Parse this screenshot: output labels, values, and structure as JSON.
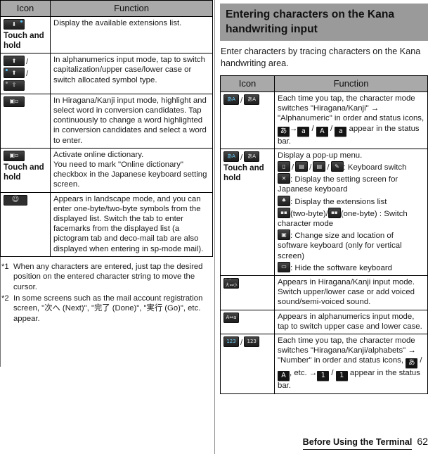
{
  "document": {
    "footer_title": "Before Using the Terminal",
    "page_number": "62"
  },
  "left_page": {
    "table": {
      "headers": {
        "icon": "Icon",
        "function": "Function"
      },
      "rows": [
        {
          "icon_note": "Touch and hold",
          "icon_glyphs": [
            "arrow-down-key-icon"
          ],
          "function": "Display the available extensions list."
        },
        {
          "icon_note": "",
          "icon_glyphs": [
            "shift-key-icon",
            "shift-key-blue-dot-icon",
            "shift-outline-key-icon"
          ],
          "function": "In alphanumerics input mode, tap to switch capitalization/upper case/lower case or switch allocated symbol type."
        },
        {
          "icon_note": "",
          "icon_glyphs": [
            "conversion-candidate-key-icon"
          ],
          "function": "In Hiragana/Kanji input mode, highlight and select word in conversion candidates. Tap continuously to change a word highlighted in conversion candidates and select a word to enter."
        },
        {
          "icon_note": "Touch and hold",
          "icon_glyphs": [
            "online-dictionary-key-icon"
          ],
          "function": "Activate online dictionary.\nYou need to mark \"Online dictionary\" checkbox in the Japanese keyboard setting screen."
        },
        {
          "icon_note": "",
          "icon_glyphs": [
            "facemark-key-icon"
          ],
          "function": "Appears in landscape mode, and you can enter one-byte/two-byte symbols from the displayed list. Switch the tab to enter facemarks from the displayed list (a pictogram tab and deco-mail tab are also displayed when entering in sp-mode mail)."
        }
      ]
    },
    "footnotes": [
      {
        "mark": "*1",
        "text": "When any characters are entered, just tap the desired position on the entered character string to move the cursor."
      },
      {
        "mark": "*2",
        "text": "In some screens such as the mail account registration screen, \"次へ (Next)\", \"完了 (Done)\", \"実行 (Go)\", etc. appear."
      }
    ]
  },
  "right_page": {
    "section_title": "Entering characters on the Kana handwriting input",
    "intro": "Enter characters by tracing characters on the Kana handwriting area.",
    "table": {
      "headers": {
        "icon": "Icon",
        "function": "Function"
      },
      "rows": [
        {
          "icon_note": "",
          "icon_glyphs": [
            "char-mode-key-icon",
            "char-mode-key-alt-icon"
          ],
          "function_parts": [
            {
              "type": "text",
              "value": "Each time you tap, the character mode switches \"Hiragana/Kanji\" → \"Alphanumeric\" in order and status icons, "
            },
            {
              "type": "status",
              "value": "あ"
            },
            {
              "type": "text",
              "value": "→"
            },
            {
              "type": "status",
              "value": "a"
            },
            {
              "type": "text",
              "value": " / "
            },
            {
              "type": "status",
              "value": "A"
            },
            {
              "type": "text",
              "value": " / "
            },
            {
              "type": "status",
              "value": "a"
            },
            {
              "type": "text",
              "value": " appear in the status bar."
            }
          ]
        },
        {
          "icon_note": "Touch and hold",
          "icon_glyphs": [
            "popup-menu-key-icon",
            "popup-menu-key-alt-icon"
          ],
          "function_lines": [
            {
              "text": "Display a pop-up menu."
            },
            {
              "icons": [
                "keypad-icon",
                "qwerty-icon",
                "full-keyboard-icon",
                "handwriting-icon"
              ],
              "text": ": Keyboard switch"
            },
            {
              "icons": [
                "settings-x-icon"
              ],
              "text": ": Display the setting screen for Japanese keyboard"
            },
            {
              "icons": [
                "extensions-icon"
              ],
              "text": ": Display the extensions list"
            },
            {
              "icons": [
                "two-byte-icon"
              ],
              "text": "(two-byte)/",
              "icons2": [
                "one-byte-icon"
              ],
              "text2": "(one-byte) : Switch character mode"
            },
            {
              "icons": [
                "resize-keyboard-icon"
              ],
              "text": ": Change size and location of software keyboard (only for vertical screen)"
            },
            {
              "icons": [
                "hide-keyboard-icon"
              ],
              "text": ": Hide the software keyboard"
            }
          ]
        },
        {
          "icon_note": "",
          "icon_glyphs": [
            "dakuten-key-icon"
          ],
          "function": "Appears in Hiragana/Kanji input mode. Switch upper/lower case or add voiced sound/semi-voiced sound."
        },
        {
          "icon_note": "",
          "icon_glyphs": [
            "case-switch-key-icon"
          ],
          "function": "Appears in alphanumerics input mode, tap to switch upper case and lower case."
        },
        {
          "icon_note": "",
          "icon_glyphs": [
            "number-mode-key-icon",
            "number-mode-key-alt-icon"
          ],
          "function_parts": [
            {
              "type": "text",
              "value": "Each time you tap, the character mode switches \"Hiragana/Kanji/alphabets\" → \"Number\" in order and status icons, "
            },
            {
              "type": "status",
              "value": "あ"
            },
            {
              "type": "text",
              "value": " / "
            },
            {
              "type": "status",
              "value": "A"
            },
            {
              "type": "text",
              "value": ", etc. →"
            },
            {
              "type": "status",
              "value": "1"
            },
            {
              "type": "text",
              "value": " / "
            },
            {
              "type": "status",
              "value": "1"
            },
            {
              "type": "text",
              "value": " appear in the status bar."
            }
          ]
        }
      ]
    }
  },
  "colors": {
    "header_gray": "#a9a9a9",
    "title_gray": "#9a9a9a",
    "border": "#000000",
    "key_dark": "#2b2b2b",
    "key_accent": "#59c8ff"
  }
}
